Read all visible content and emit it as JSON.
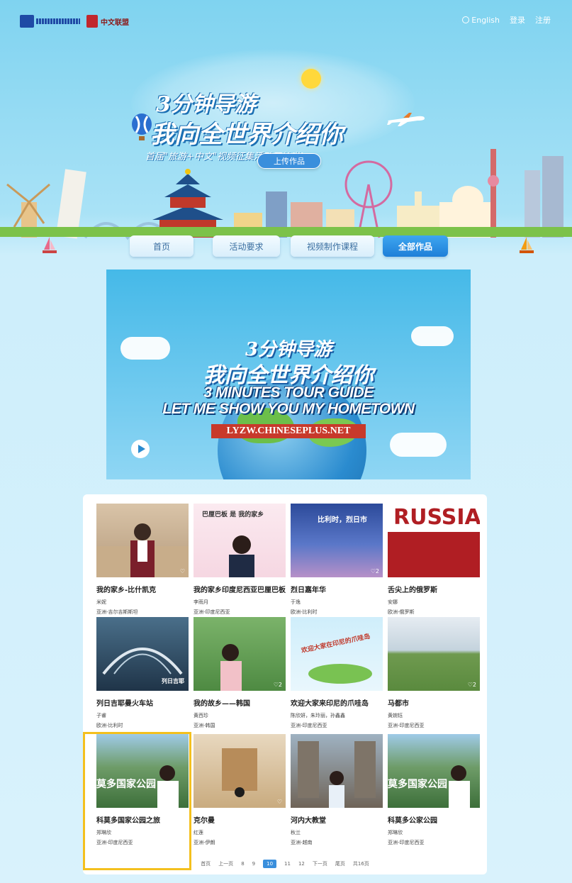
{
  "topbar": {
    "logo1_label": "",
    "logo2_label": "中文联盟",
    "lang_label": "English",
    "login": "登录",
    "register": "注册"
  },
  "hero": {
    "line1": "3分钟导游",
    "line2": "我向全世界介绍你",
    "line3": "首届\"旅游+中文\"视频征集活动开始啦!",
    "upload_button": "上传作品"
  },
  "nav": {
    "items": [
      "首页",
      "活动要求",
      "视频制作课程",
      "全部作品"
    ],
    "active_index": 3
  },
  "banner": {
    "line1": "3分钟导游",
    "line2": "我向全世界介绍你",
    "line3": "3 MINUTES TOUR GUIDE",
    "line4": "LET ME SHOW YOU MY HOMETOWN",
    "url": "LYZW.CHINESEPLUS.NET"
  },
  "works": [
    {
      "title": "我的家乡-比什凯克",
      "author": "米妮",
      "region": "亚洲-吉尔吉斯斯坦",
      "overlay": ""
    },
    {
      "title": "我的家乡印度尼西亚巴厘巴板",
      "author": "李雨月",
      "region": "亚洲-印度尼西亚",
      "overlay": "巴厘巴板 是 我的家乡"
    },
    {
      "title": "烈日嘉年华",
      "author": "于逸",
      "region": "欧洲-比利时",
      "overlay": "比利时，烈日市"
    },
    {
      "title": "舌尖上的俄罗斯",
      "author": "安娜",
      "region": "欧洲-俄罗斯",
      "overlay": "RUSSIA"
    },
    {
      "title": "列日吉耶曼火车站",
      "author": "子睿",
      "region": "欧洲-比利时",
      "overlay": "列日吉耶"
    },
    {
      "title": "我的故乡——韩国",
      "author": "黄西珍",
      "region": "亚洲-韩国",
      "overlay": ""
    },
    {
      "title": "欢迎大家来印尼的爪哇岛",
      "author": "陈欣妍，朱玲丽，孙鑫鑫",
      "region": "亚洲-印度尼西亚",
      "overlay": "欢迎大家在印尼的爪哇岛"
    },
    {
      "title": "马都市",
      "author": "黄婉钰",
      "region": "亚洲-印度尼西亚",
      "overlay": ""
    },
    {
      "title": "科莫多国家公园之旅",
      "author": "郑琳欣",
      "region": "亚洲-印度尼西亚",
      "overlay": "莫多国家公园"
    },
    {
      "title": "克尔曼",
      "author": "红莲",
      "region": "亚洲-伊朗",
      "overlay": ""
    },
    {
      "title": "河内大教堂",
      "author": "秋兰",
      "region": "亚洲-越南",
      "overlay": ""
    },
    {
      "title": "科莫多公家公园",
      "author": "郑琳欣",
      "region": "亚洲-印度尼西亚",
      "overlay": "莫多国家公园"
    }
  ],
  "pager": {
    "first": "首页",
    "prev": "上一页",
    "pages": [
      "8",
      "9",
      "10",
      "11",
      "12"
    ],
    "current": "10",
    "next": "下一页",
    "last": "尾页",
    "total": "共16页"
  },
  "colors": {
    "accent": "#3a8fdc",
    "highlight": "#f4c01e"
  }
}
